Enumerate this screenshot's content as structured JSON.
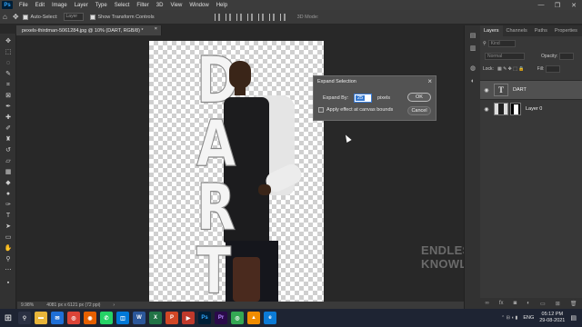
{
  "menubar": {
    "logo": "Ps",
    "items": [
      "File",
      "Edit",
      "Image",
      "Layer",
      "Type",
      "Select",
      "Filter",
      "3D",
      "View",
      "Window",
      "Help"
    ],
    "controls": [
      "—",
      "❐",
      "✕"
    ]
  },
  "options": {
    "auto_select_label": "Auto-Select:",
    "auto_select_value": "Layer",
    "transform_label": "Show Transform Controls",
    "mode_label": "3D Mode:"
  },
  "document": {
    "tab_title": "pexels-thirdman-5061284.jpg @ 10% (DART, RGB/8) *",
    "canvas_letters": [
      "D",
      "A",
      "R",
      "T"
    ],
    "watermark": "ENDLESS KNOWLEDGE"
  },
  "dialog": {
    "title": "Expand Selection",
    "expand_label": "Expand By:",
    "expand_value": "25",
    "unit": "pixels",
    "apply_label": "Apply effect at canvas bounds",
    "apply_checked": false,
    "ok_label": "OK",
    "cancel_label": "Cancel"
  },
  "status": {
    "zoom": "9.98%",
    "doc_size": "4081 px x 6121 px (72 ppi)"
  },
  "layers_panel": {
    "tabs": [
      "Layers",
      "Channels",
      "Paths",
      "Properties"
    ],
    "kind_label": "Kind",
    "blend_mode": "Normal",
    "opacity_label": "Opacity:",
    "lock_label": "Lock:",
    "fill_label": "Fill:",
    "layers": [
      {
        "name": "DART",
        "thumb": "T",
        "selected": true
      },
      {
        "name": "Layer 0",
        "thumb": "",
        "selected": false
      }
    ],
    "footer_icons": [
      "link-icon",
      "fx-icon",
      "mask-icon",
      "adjustment-icon",
      "folder-icon",
      "new-layer-icon",
      "trash-icon"
    ]
  },
  "taskbar": {
    "apps": [
      "search",
      "files",
      "mail",
      "chrome",
      "firefox",
      "whatsapp",
      "store",
      "word",
      "excel",
      "powerpoint",
      "photoshop",
      "premiere",
      "chrome2",
      "vlc",
      "edge"
    ],
    "language": "ENG",
    "time": "05:12 PM",
    "date": "29-08-2021"
  },
  "colors": {
    "accent": "#3478d0",
    "panel": "#383838",
    "workspace": "#282828"
  }
}
